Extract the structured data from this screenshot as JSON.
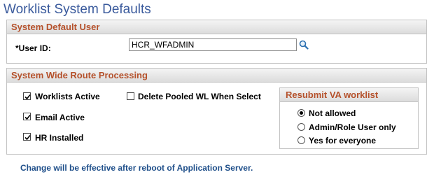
{
  "page": {
    "title": "Worklist System Defaults"
  },
  "system_default_user": {
    "header": "System Default User",
    "user_id_label": "*User ID:",
    "user_id_value": "HCR_WFADMIN",
    "lookup_icon": "magnifier-lookup-icon"
  },
  "route_processing": {
    "header": "System Wide Route Processing",
    "checkboxes": [
      {
        "label": "Worklists Active",
        "checked": true
      },
      {
        "label": "Email Active",
        "checked": true
      },
      {
        "label": "HR Installed",
        "checked": true
      },
      {
        "label": "Delete Pooled WL When Select",
        "checked": false
      }
    ],
    "resubmit": {
      "header": "Resubmit VA worklist",
      "options": [
        {
          "label": "Not allowed",
          "selected": true
        },
        {
          "label": "Admin/Role User only",
          "selected": false
        },
        {
          "label": "Yes for everyone",
          "selected": false
        }
      ]
    }
  },
  "footer": {
    "note": "Change will be effective after reboot of Application Server."
  },
  "colors": {
    "title": "#3a5a9c",
    "group_header_text": "#b5512b",
    "footer_text": "#1f4f8a",
    "border": "#c3c3c3"
  }
}
